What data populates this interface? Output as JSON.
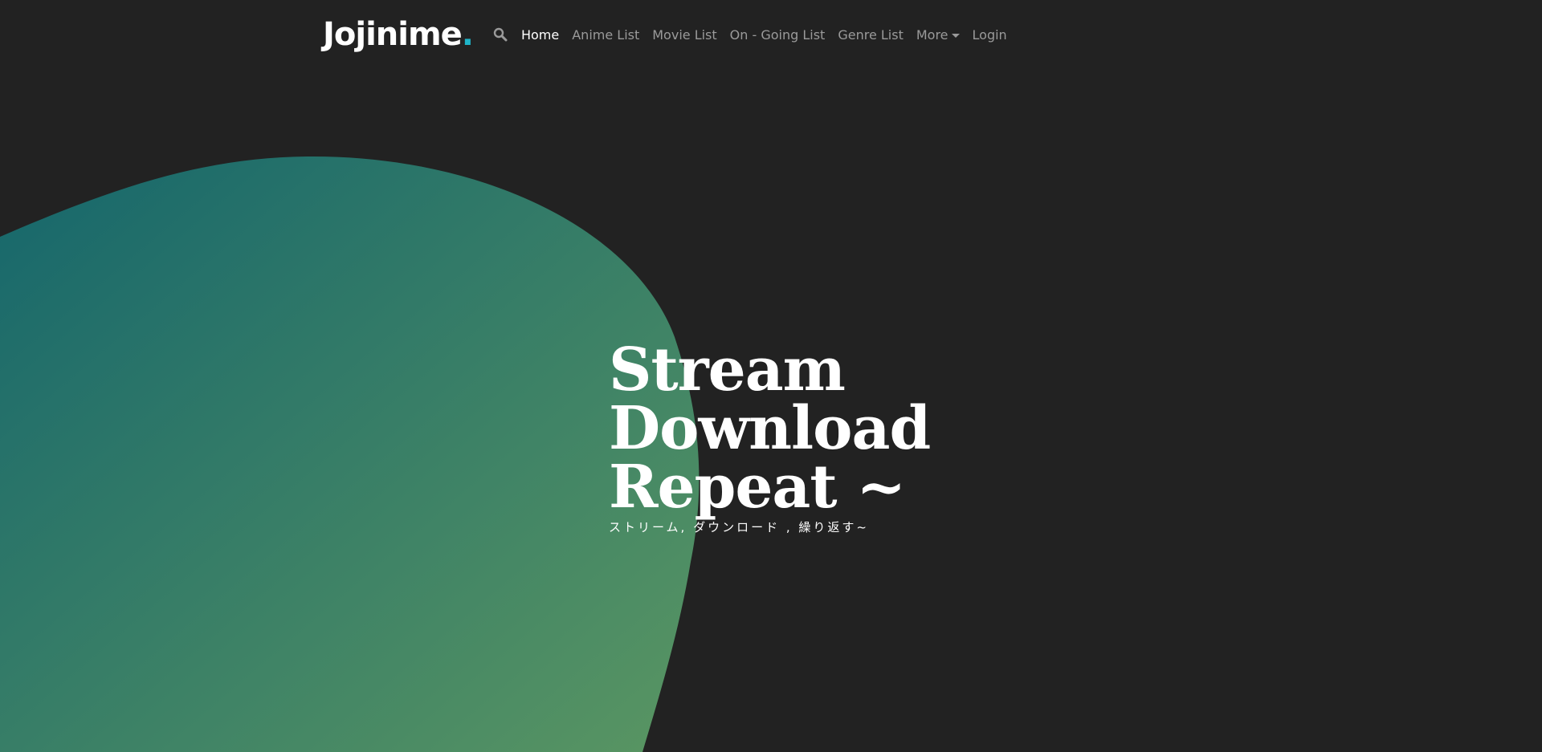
{
  "colors": {
    "background": "#222222",
    "brand_dot": "#1fb5c9",
    "nav_active": "#ffffff",
    "nav_inactive": "#9a9a9a",
    "blob_gradient_start": "#15666c",
    "blob_gradient_end": "#5a9662"
  },
  "navbar": {
    "brand": {
      "name": "Jojinime",
      "dot": "."
    },
    "search_icon": "search-icon",
    "links": {
      "home": "Home",
      "anime_list": "Anime List",
      "movie_list": "Movie List",
      "ongoing_list": "On - Going List",
      "genre_list": "Genre List",
      "more": "More",
      "login": "Login"
    },
    "active": "home"
  },
  "hero": {
    "line1": "Stream",
    "line2": "Download",
    "line3": "Repeat ~",
    "subtitle": "ストリーム, ダウンロード , 繰り返す~"
  }
}
